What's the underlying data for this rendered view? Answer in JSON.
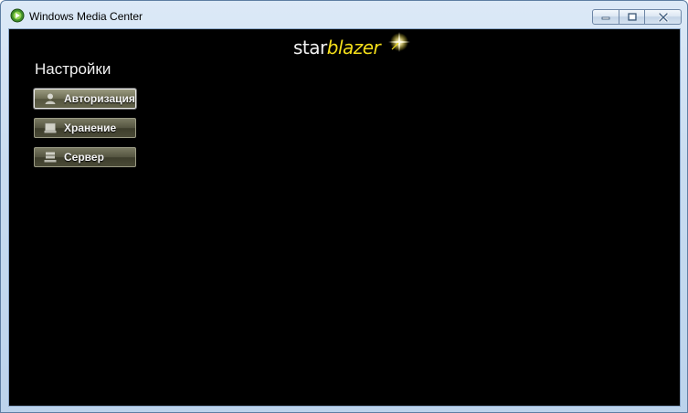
{
  "window": {
    "title": "Windows Media Center",
    "app_icon": "windows-media-center-icon",
    "controls": [
      "minimize-icon",
      "maximize-icon",
      "close-icon"
    ]
  },
  "logo": {
    "part1": "star",
    "part2": "blazer",
    "sparkle_icon": "sparkle-icon"
  },
  "settings": {
    "title": "Настройки",
    "items": [
      {
        "label": "Авторизация",
        "icon": "user-icon",
        "selected": true
      },
      {
        "label": "Хранение",
        "icon": "storage-icon",
        "selected": false
      },
      {
        "label": "Сервер",
        "icon": "server-icon",
        "selected": false
      }
    ]
  },
  "colors": {
    "background": "#000000",
    "logo_accent": "#f4de1a",
    "button_olive": "#545440"
  }
}
